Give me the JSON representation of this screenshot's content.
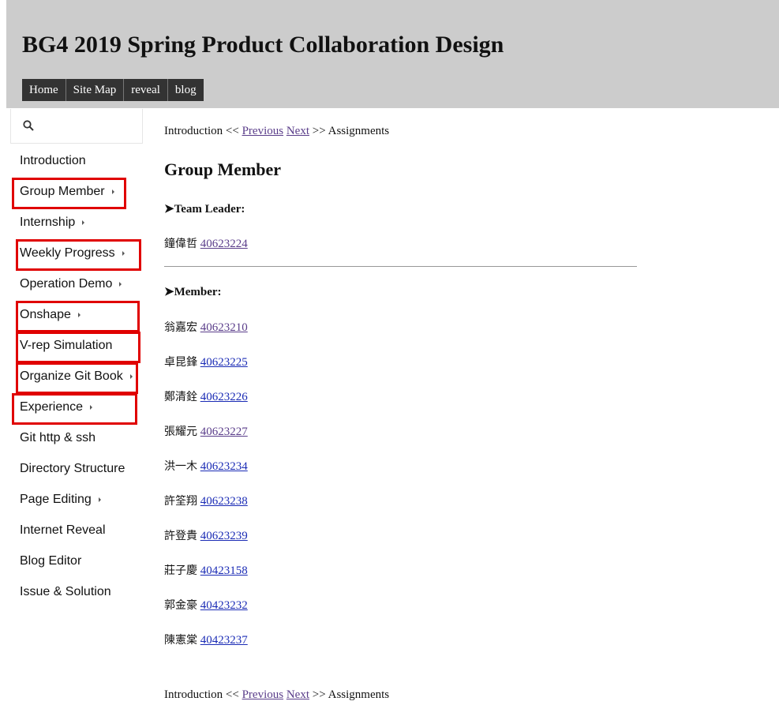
{
  "site": {
    "title": "BG4 2019 Spring Product Collaboration Design",
    "nav": [
      "Home",
      "Site Map",
      "reveal",
      "blog"
    ]
  },
  "search": {
    "icon": "search-icon"
  },
  "sidebar": {
    "items": [
      {
        "label": "Introduction",
        "has_submenu": false,
        "highlighted": false
      },
      {
        "label": "Group Member",
        "has_submenu": true,
        "highlighted": true
      },
      {
        "label": "Internship",
        "has_submenu": true,
        "highlighted": false
      },
      {
        "label": "Weekly Progress",
        "has_submenu": true,
        "highlighted": true
      },
      {
        "label": "Operation Demo",
        "has_submenu": true,
        "highlighted": false
      },
      {
        "label": "Onshape",
        "has_submenu": true,
        "highlighted": true
      },
      {
        "label": "V-rep Simulation",
        "has_submenu": false,
        "highlighted": true
      },
      {
        "label": "Organize Git Book",
        "has_submenu": true,
        "highlighted": true
      },
      {
        "label": "Experience",
        "has_submenu": true,
        "highlighted": true
      },
      {
        "label": "Git http & ssh",
        "has_submenu": false,
        "highlighted": false
      },
      {
        "label": "Directory Structure",
        "has_submenu": false,
        "highlighted": false
      },
      {
        "label": "Page Editing",
        "has_submenu": true,
        "highlighted": false
      },
      {
        "label": "Internet Reveal",
        "has_submenu": false,
        "highlighted": false
      },
      {
        "label": "Blog Editor",
        "has_submenu": false,
        "highlighted": false
      },
      {
        "label": "Issue & Solution",
        "has_submenu": false,
        "highlighted": false
      }
    ],
    "highlight_color": "#e00000"
  },
  "breadcrumb": {
    "prev_page": "Introduction",
    "prev_sep": "<<",
    "prev_label": "Previous",
    "next_label": "Next",
    "next_sep": ">>",
    "next_page": "Assignments"
  },
  "main": {
    "title": "Group Member",
    "leader_heading": "➤Team Leader:",
    "leader": {
      "name": "鐘偉哲",
      "id": "40623224"
    },
    "member_heading": "➤Member:",
    "members": [
      {
        "name": "翁嘉宏",
        "id": "40623210"
      },
      {
        "name": "卓昆鋒",
        "id": "40623225"
      },
      {
        "name": "鄭清銓",
        "id": "40623226"
      },
      {
        "name": "張耀元",
        "id": "40623227"
      },
      {
        "name": "洪一木",
        "id": "40623234"
      },
      {
        "name": "許筌翔",
        "id": "40623238"
      },
      {
        "name": "許登貴",
        "id": "40623239"
      },
      {
        "name": "莊子慶",
        "id": "40423158"
      },
      {
        "name": "郭金豪",
        "id": "40423232"
      },
      {
        "name": "陳憲棠",
        "id": "40423237"
      }
    ]
  }
}
